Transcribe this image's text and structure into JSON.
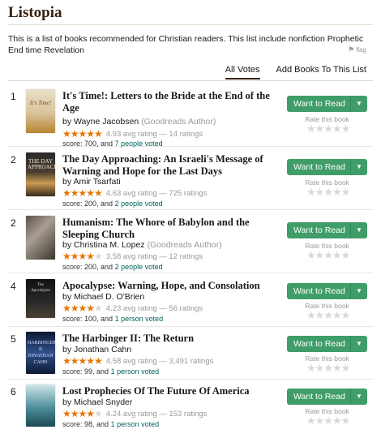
{
  "header": {
    "title": "Listopia",
    "description": "This is a list of books recommended for Christian readers. This list include nonfiction Prophetic End time Revelation",
    "flag_label": "flag"
  },
  "tabs": [
    {
      "label": "All Votes",
      "active": true
    },
    {
      "label": "Add Books To This List",
      "active": false
    }
  ],
  "list_ui": {
    "want_to_read": "Want to Read",
    "rate_label": "Rate this book",
    "goodreads_author": "(Goodreads Author)",
    "colors": {
      "accent_green": "#409d69",
      "star_orange": "#e87400",
      "link_teal": "#00635d",
      "title_brown": "#382110"
    }
  },
  "books": [
    {
      "rank": "1",
      "title": "It's Time!: Letters to the Bride at the End of the Age",
      "by": "by",
      "author": "Wayne Jacobsen",
      "goodreads_author": true,
      "stars": 5,
      "rating_text": "4.93 avg rating — 14 ratings",
      "score_text": "score: 700, and",
      "voted_text": "7 people voted",
      "cover_text": "It's Time!"
    },
    {
      "rank": "2",
      "title": "The Day Approaching: An Israeli's Message of Warning and Hope for the Last Days",
      "by": "by",
      "author": "Amir Tsarfati",
      "goodreads_author": false,
      "stars": 5,
      "rating_text": "4.63 avg rating — 725 ratings",
      "score_text": "score: 200, and",
      "voted_text": "2 people voted",
      "cover_text": "THE DAY APPROACHING"
    },
    {
      "rank": "2",
      "title": "Humanism: The Whore of Babylon and the Sleeping Church",
      "by": "by",
      "author": "Christina M. Lopez",
      "goodreads_author": true,
      "stars": 3.5,
      "rating_text": "3.58 avg rating — 12 ratings",
      "score_text": "score: 200, and",
      "voted_text": "2 people voted",
      "cover_text": ""
    },
    {
      "rank": "4",
      "title": "Apocalypse: Warning, Hope, and Consolation",
      "by": "by",
      "author": "Michael D. O'Brien",
      "goodreads_author": false,
      "stars": 4,
      "rating_text": "4.23 avg rating — 56 ratings",
      "score_text": "score: 100, and",
      "voted_text": "1 person voted",
      "cover_text": "The Apocalypse"
    },
    {
      "rank": "5",
      "title": "The Harbinger II: The Return",
      "by": "by",
      "author": "Jonathan Cahn",
      "goodreads_author": false,
      "stars": 4.5,
      "rating_text": "4.58 avg rating — 3,491 ratings",
      "score_text": "score: 99, and",
      "voted_text": "1 person voted",
      "cover_text": "HARBINGER II JONATHAN CAHN"
    },
    {
      "rank": "6",
      "title": "Lost Prophecies Of The Future Of America",
      "by": "by",
      "author": "Michael Snyder",
      "goodreads_author": false,
      "stars": 4,
      "rating_text": "4.24 avg rating — 153 ratings",
      "score_text": "score: 98, and",
      "voted_text": "1 person voted",
      "cover_text": ""
    }
  ]
}
